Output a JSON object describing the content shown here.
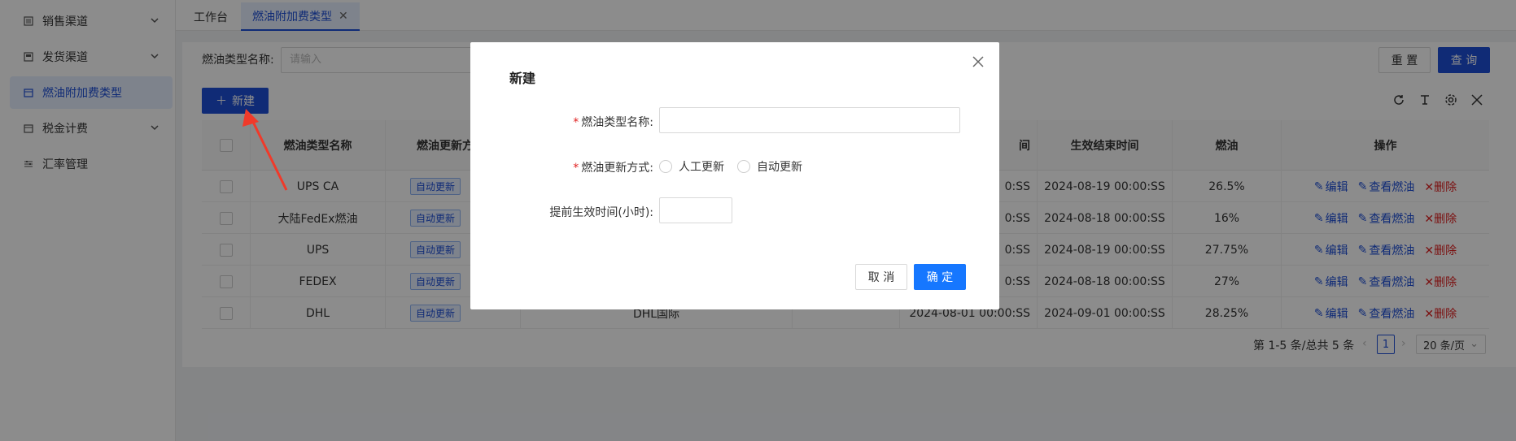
{
  "sidebar": {
    "items": [
      {
        "label": "销售渠道",
        "icon": "list-icon",
        "expandable": true
      },
      {
        "label": "发货渠道",
        "icon": "box-icon",
        "expandable": true
      },
      {
        "label": "燃油附加费类型",
        "icon": "calendar-icon",
        "expandable": false,
        "active": true
      },
      {
        "label": "税金计费",
        "icon": "calendar-icon",
        "expandable": true
      },
      {
        "label": "汇率管理",
        "icon": "sliders-icon",
        "expandable": false
      }
    ]
  },
  "tabs": [
    {
      "label": "工作台",
      "active": false
    },
    {
      "label": "燃油附加费类型",
      "active": true,
      "closable": true
    }
  ],
  "filter": {
    "label": "燃油类型名称:",
    "placeholder": "请输入",
    "reset_label": "重 置",
    "query_label": "查 询"
  },
  "toolbar": {
    "new_label": "新建"
  },
  "table": {
    "headers": [
      "燃油类型名称",
      "燃油更新方",
      "",
      "",
      "间",
      "生效结束时间",
      "燃油",
      "操作"
    ],
    "rows": [
      {
        "name": "UPS CA",
        "update": "自动更新",
        "channel": "",
        "start": "0:SS",
        "end": "2024-08-19 00:00:SS",
        "fuel": "26.5%"
      },
      {
        "name": "大陆FedEx燃油",
        "update": "自动更新",
        "channel": "",
        "start": "0:SS",
        "end": "2024-08-18 00:00:SS",
        "fuel": "16%"
      },
      {
        "name": "UPS",
        "update": "自动更新",
        "channel": "",
        "start": "0:SS",
        "end": "2024-08-19 00:00:SS",
        "fuel": "27.75%"
      },
      {
        "name": "FEDEX",
        "update": "自动更新",
        "channel": "",
        "start": "0:SS",
        "end": "2024-08-18 00:00:SS",
        "fuel": "27%"
      },
      {
        "name": "DHL",
        "update": "自动更新",
        "channel": "DHL国际",
        "start": "2024-08-01 00:00:SS",
        "end": "2024-09-01 00:00:SS",
        "fuel": "28.25%"
      }
    ],
    "actions": {
      "edit": "编辑",
      "view": "查看燃油",
      "delete": "删除"
    }
  },
  "pagination": {
    "summary": "第 1-5 条/总共 5 条",
    "current_page": "1",
    "page_size": "20 条/页"
  },
  "modal": {
    "title": "新建",
    "field_name_label": "燃油类型名称:",
    "field_update_label": "燃油更新方式:",
    "option_manual": "人工更新",
    "option_auto": "自动更新",
    "field_advance_label": "提前生效时间(小时):",
    "cancel_label": "取 消",
    "confirm_label": "确 定"
  },
  "colors": {
    "primary": "#1e4fd8",
    "danger": "#e02020",
    "annotation_arrow": "#f03a2a"
  }
}
